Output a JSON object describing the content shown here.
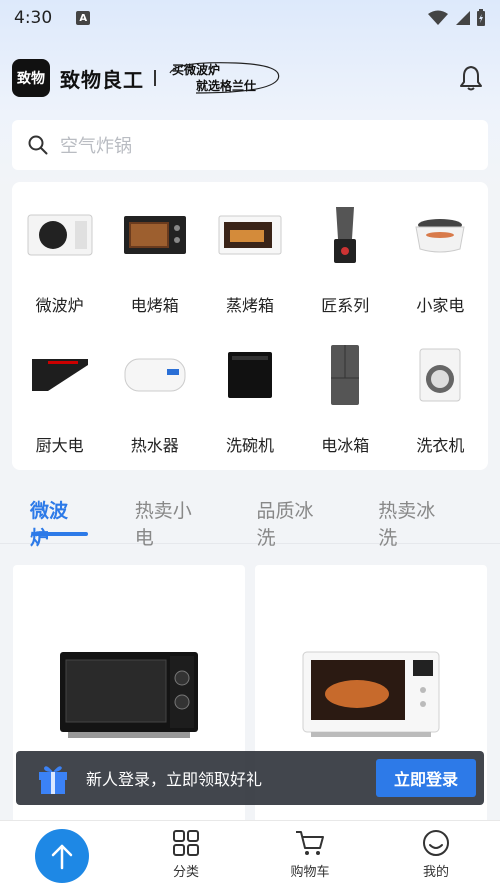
{
  "status_bar": {
    "time": "4:30",
    "notification_letter": "A"
  },
  "header": {
    "logo_text": "致物",
    "brand_name": "致物良工",
    "slogan_line1": "买微波炉",
    "slogan_line2": "就选格兰仕"
  },
  "search": {
    "placeholder": "空气炸锅"
  },
  "categories": [
    {
      "label": "微波炉",
      "icon": "microwave"
    },
    {
      "label": "电烤箱",
      "icon": "oven"
    },
    {
      "label": "蒸烤箱",
      "icon": "steam-oven"
    },
    {
      "label": "匠系列",
      "icon": "blender"
    },
    {
      "label": "小家电",
      "icon": "cooker"
    },
    {
      "label": "厨大电",
      "icon": "range-hood"
    },
    {
      "label": "热水器",
      "icon": "water-heater"
    },
    {
      "label": "洗碗机",
      "icon": "dishwasher"
    },
    {
      "label": "电冰箱",
      "icon": "fridge"
    },
    {
      "label": "洗衣机",
      "icon": "washing-machine"
    }
  ],
  "tabs": [
    "微波炉",
    "热卖小电",
    "品质冰洗",
    "热卖冰洗"
  ],
  "active_tab_index": 0,
  "login_banner": {
    "text": "新人登录，立即领取好礼",
    "button": "立即登录"
  },
  "bottom_nav": [
    {
      "label": "分类",
      "icon": "grid-icon"
    },
    {
      "label": "购物车",
      "icon": "cart-icon"
    },
    {
      "label": "我的",
      "icon": "smile-icon"
    }
  ],
  "colors": {
    "accent": "#2d7ae8",
    "top_button": "#1e88e5",
    "banner_bg": "#2c3038"
  }
}
